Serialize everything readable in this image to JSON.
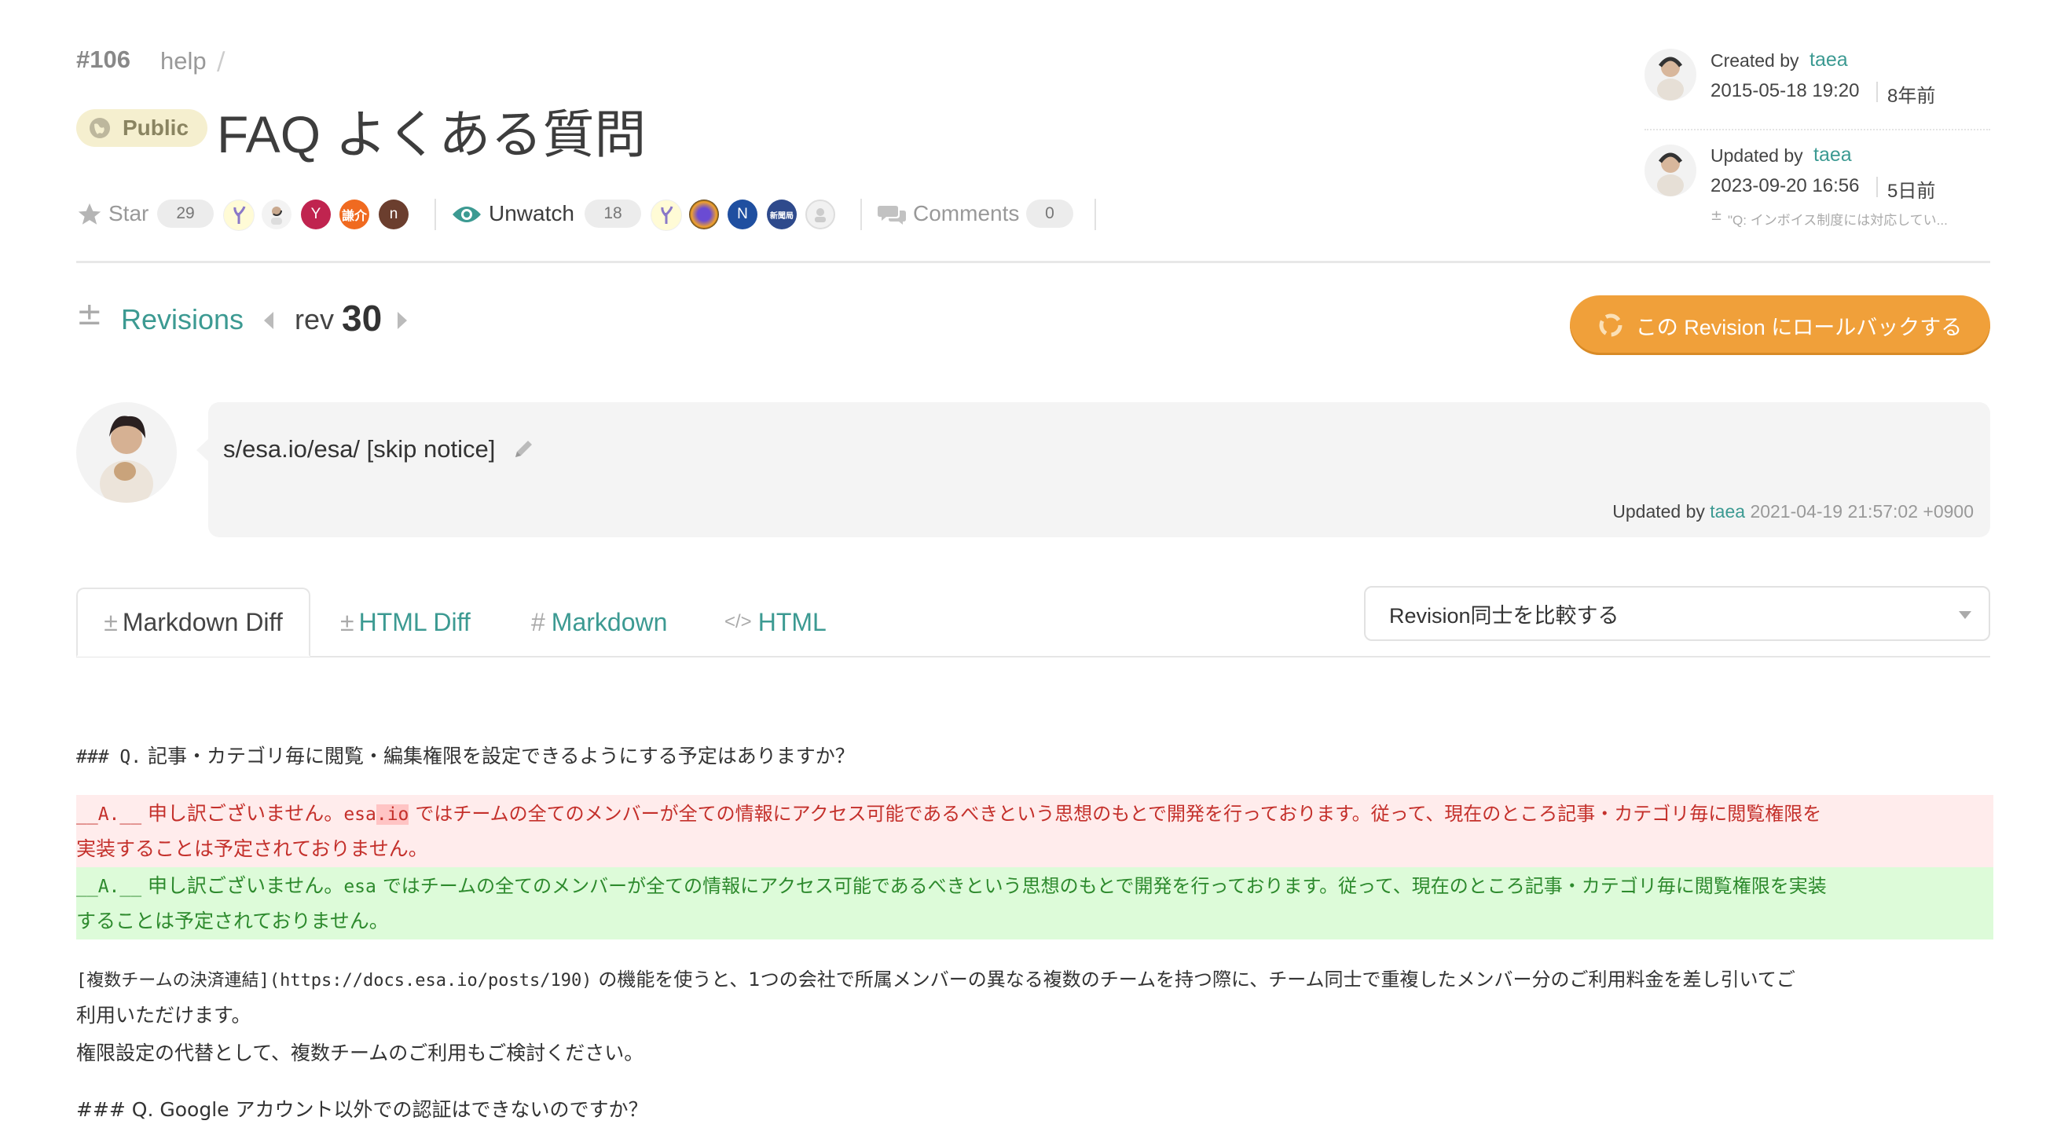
{
  "post": {
    "number": "#106",
    "category": "help",
    "category_sep": "/",
    "visibility": "Public",
    "title": "FAQ よくある質問"
  },
  "meta": {
    "created_label": "Created by",
    "created_user": "taea",
    "created_date": "2015-05-18 19:20",
    "created_ago": "8年前",
    "updated_label": "Updated by",
    "updated_user": "taea",
    "updated_date": "2023-09-20 16:56",
    "updated_ago": "5日前",
    "update_message": "\"Q: インボイス制度には対応してい..."
  },
  "actions": {
    "star_label": "Star",
    "star_count": "29",
    "star_avatars": [
      "Y",
      "謙介",
      "n"
    ],
    "watch_label": "Unwatch",
    "watch_count": "18",
    "watch_avatars": [
      "N",
      "新聞局"
    ],
    "comments_label": "Comments",
    "comments_count": "0"
  },
  "revision": {
    "revisions_label": "Revisions",
    "rev_prefix": "rev",
    "rev_number": "30",
    "rollback_label": "この Revision にロールバックする",
    "message": "s/esa.io/esa/ [skip notice]",
    "updated_by_label": "Updated by",
    "updated_by_user": "taea",
    "updated_at": "2021-04-19 21:57:02 +0900"
  },
  "tabs": [
    {
      "icon": "±",
      "label": "Markdown Diff"
    },
    {
      "icon": "±",
      "label": "HTML Diff"
    },
    {
      "icon": "#",
      "label": "Markdown"
    },
    {
      "icon": "</>",
      "label": "HTML"
    }
  ],
  "compare_select": "Revision同士を比較する",
  "diff": {
    "heading1_mono": "### Q.",
    "heading1_text": "記事・カテゴリ毎に閲覧・編集権限を設定できるようにする予定はありますか？",
    "removed_prefix": "__A.__",
    "removed_text_a": "申し訳ございません。",
    "removed_code": "esa",
    "removed_code_hl": ".io",
    "removed_text_b": "ではチームの全てのメンバーが全ての情報にアクセス可能であるべきという思想のもとで開発を行っております。従って、現在のところ記事・カテゴリ毎に閲覧権限を",
    "removed_line2": "実装することは予定されておりません。",
    "added_prefix": "__A.__",
    "added_text_a": "申し訳ございません。",
    "added_code": "esa",
    "added_text_b": "ではチームの全てのメンバーが全ての情報にアクセス可能であるべきという思想のもとで開発を行っております。従って、現在のところ記事・カテゴリ毎に閲覧権限を実装",
    "added_line2": "することは予定されておりません。",
    "para_link_mono": "[複数チームの決済連結](https://docs.esa.io/posts/190)",
    "para_text1": "の機能を使うと、1つの会社で所属メンバーの異なる複数のチームを持つ際に、チーム同士で重複したメンバー分のご利用料金を差し引いてご",
    "para_text2": "利用いただけます。",
    "para_text3": "権限設定の代替として、複数チームのご利用もご検討ください。",
    "heading2": "### Q. Google アカウント以外での認証はできないのですか？"
  },
  "colors": {
    "accent": "#3c9a92",
    "rollback": "#f0a03a",
    "removed_bg": "#ffecec",
    "removed_text": "#c4302b",
    "added_bg": "#ddfbd9",
    "added_text": "#2d8a2d"
  }
}
